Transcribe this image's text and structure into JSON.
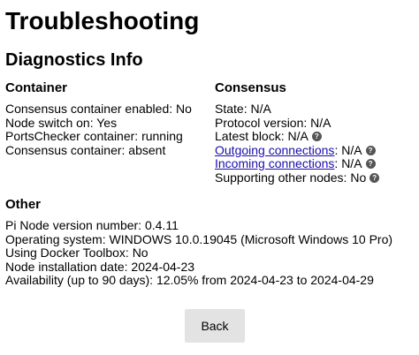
{
  "page": {
    "title": "Troubleshooting",
    "section_title": "Diagnostics Info"
  },
  "container": {
    "heading": "Container",
    "lines": [
      "Consensus container enabled: No",
      "Node switch on: Yes",
      "PortsChecker container: running",
      "Consensus container: absent"
    ]
  },
  "consensus": {
    "heading": "Consensus",
    "state": "State: N/A",
    "protocol_version": "Protocol version: N/A",
    "latest_block": "Latest block: N/A",
    "outgoing_link": "Outgoing connections",
    "outgoing_value": ": N/A",
    "incoming_link": "Incoming connections",
    "incoming_value": ": N/A",
    "supporting": "Supporting other nodes: No",
    "help_glyph": "?",
    "help_icon": "question-circle-icon"
  },
  "other": {
    "heading": "Other",
    "lines": [
      "Pi Node version number: 0.4.11",
      "Operating system: WINDOWS 10.0.19045 (Microsoft Windows 10 Pro)",
      "Using Docker Toolbox: No",
      "Node installation date: 2024-04-23",
      "Availability (up to 90 days): 12.05% from 2024-04-23 to 2024-04-29"
    ]
  },
  "actions": {
    "back_label": "Back"
  }
}
